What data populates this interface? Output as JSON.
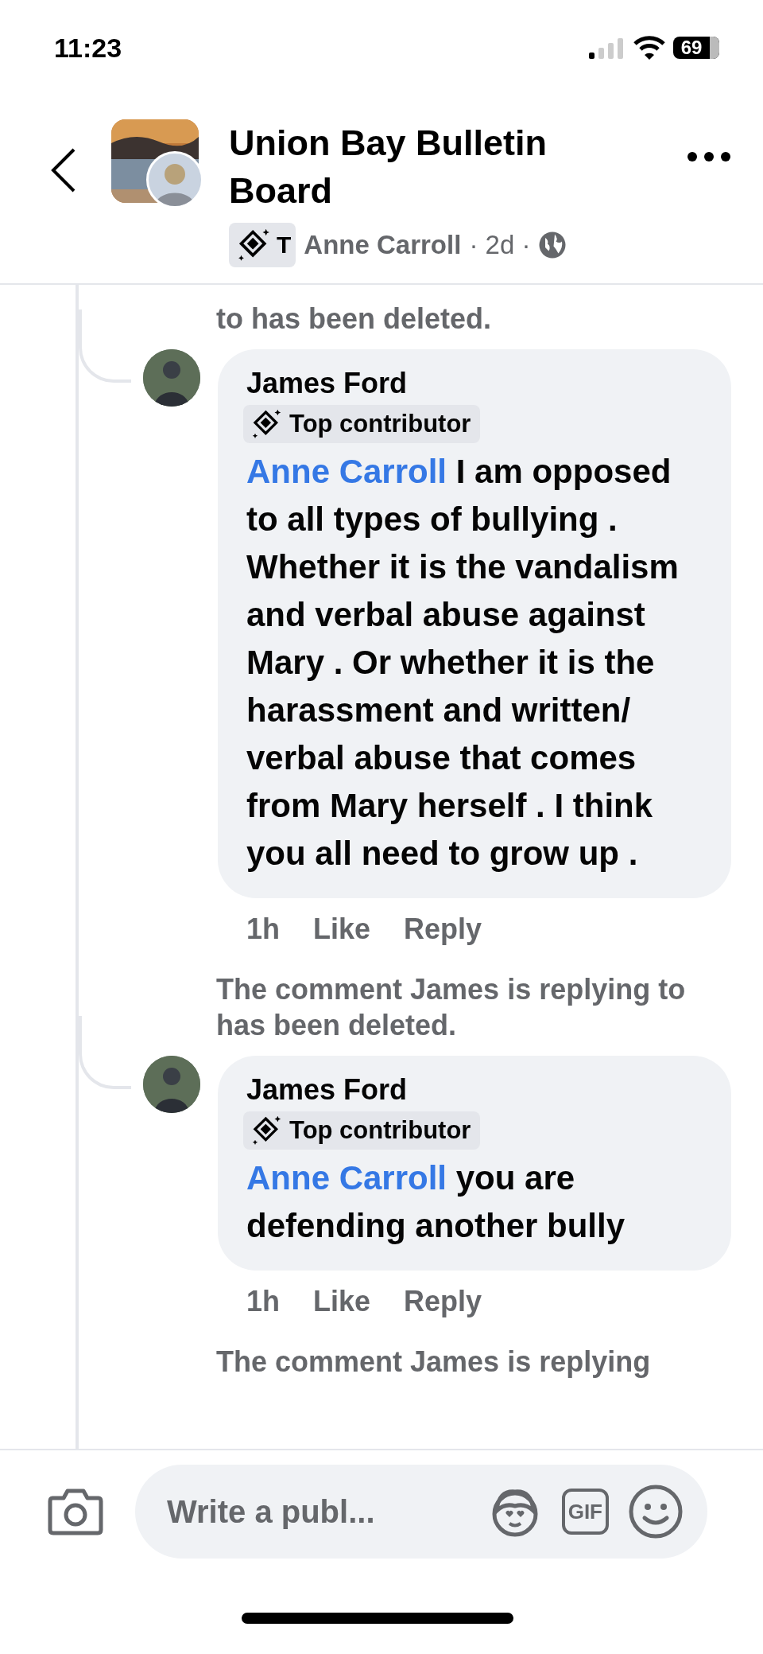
{
  "status_bar": {
    "time": "11:23",
    "battery": "69"
  },
  "header": {
    "title": "Union Bay Bulletin Board",
    "badge": "T",
    "author": "Anne Carroll",
    "meta": "· 2d ·"
  },
  "thread": [
    {
      "kind": "notice",
      "text": "to has been deleted."
    },
    {
      "kind": "comment",
      "author": "James Ford",
      "badge": "Top contributor",
      "mention": "Anne Carroll",
      "text": "I am opposed to all types of bullying . Whether it is the vandalism and verbal abuse against Mary . Or whether it is the harassment and written/ verbal abuse that comes from Mary herself . I think you all need to grow up .",
      "time": "1h",
      "actions": [
        "Like",
        "Reply"
      ]
    },
    {
      "kind": "notice",
      "text": "The comment James is replying to has been deleted."
    },
    {
      "kind": "comment",
      "author": "James Ford",
      "badge": "Top contributor",
      "mention": "Anne Carroll",
      "text": "you are defending another bully",
      "time": "1h",
      "actions": [
        "Like",
        "Reply"
      ]
    },
    {
      "kind": "notice",
      "text": "The comment James is replying"
    }
  ],
  "composer": {
    "placeholder": "Write a publ...",
    "gif": "GIF"
  }
}
